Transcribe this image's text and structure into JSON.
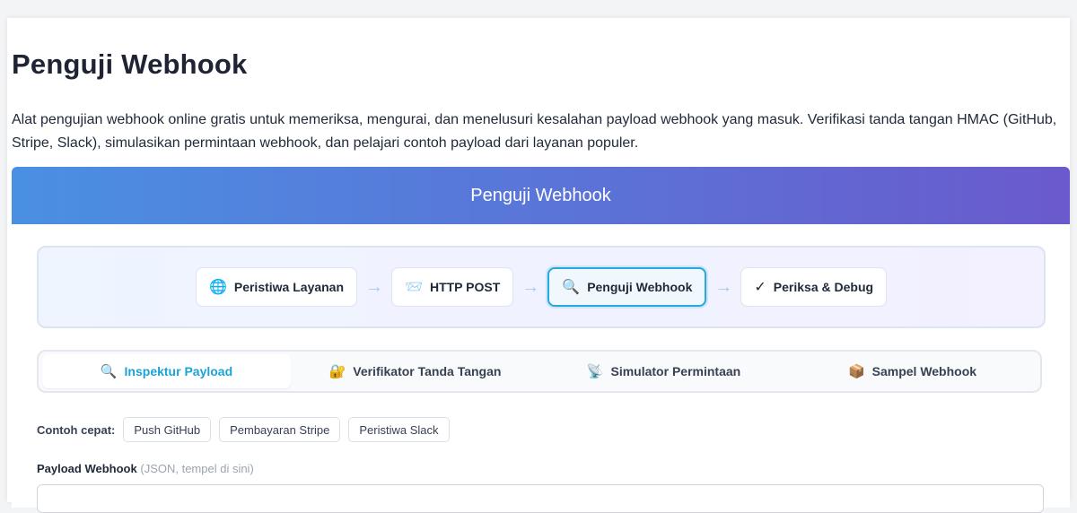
{
  "page": {
    "title": "Penguji Webhook",
    "intro": "Alat pengujian webhook online gratis untuk memeriksa, mengurai, dan menelusuri kesalahan payload webhook yang masuk. Verifikasi tanda tangan HMAC (GitHub, Stripe, Slack), simulasikan permintaan webhook, dan pelajari contoh payload dari layanan populer."
  },
  "app": {
    "header_title": "Penguji Webhook",
    "flow": [
      {
        "icon": "🌐",
        "label": "Peristiwa Layanan"
      },
      {
        "icon": "📨",
        "label": "HTTP POST"
      },
      {
        "icon": "🔍",
        "label": "Penguji Webhook"
      },
      {
        "icon": "✓",
        "label": "Periksa & Debug"
      }
    ],
    "arrow": "→",
    "tabs": [
      {
        "icon": "🔍",
        "label": "Inspektur Payload"
      },
      {
        "icon": "🔐",
        "label": "Verifikator Tanda Tangan"
      },
      {
        "icon": "📡",
        "label": "Simulator Permintaan"
      },
      {
        "icon": "📦",
        "label": "Sampel Webhook"
      }
    ],
    "quick_examples": {
      "label": "Contoh cepat:",
      "items": [
        "Push GitHub",
        "Pembayaran Stripe",
        "Peristiwa Slack"
      ]
    },
    "payload_field": {
      "label": "Payload Webhook",
      "hint": "(JSON, tempel di sini)"
    }
  },
  "colors": {
    "header_gradient_start": "#4a90e2",
    "header_gradient_end": "#6a5acd",
    "accent": "#1aa3d6"
  }
}
